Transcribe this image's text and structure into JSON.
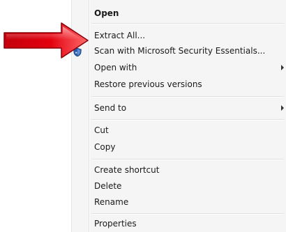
{
  "context_menu": {
    "items": [
      {
        "label": "Open",
        "bold": true,
        "submenu": false
      },
      {
        "label": "Extract All...",
        "bold": false,
        "submenu": false
      },
      {
        "label": "Scan with Microsoft Security Essentials...",
        "bold": false,
        "submenu": false
      },
      {
        "label": "Open with",
        "bold": false,
        "submenu": true
      },
      {
        "label": "Restore previous versions",
        "bold": false,
        "submenu": false
      },
      {
        "label": "Send to",
        "bold": false,
        "submenu": true
      },
      {
        "label": "Cut",
        "bold": false,
        "submenu": false
      },
      {
        "label": "Copy",
        "bold": false,
        "submenu": false
      },
      {
        "label": "Create shortcut",
        "bold": false,
        "submenu": false
      },
      {
        "label": "Delete",
        "bold": false,
        "submenu": false
      },
      {
        "label": "Rename",
        "bold": false,
        "submenu": false
      },
      {
        "label": "Properties",
        "bold": false,
        "submenu": false
      }
    ]
  },
  "icons": {
    "scan_item": "shield-icon",
    "annotation": "red-arrow-icon",
    "submenu": "chevron-right-icon"
  },
  "colors": {
    "menu_background": "#f5f5f5",
    "text": "#1a1a1a",
    "arrow_red": "#e3000f",
    "shield_blue": "#2a5aa8"
  }
}
